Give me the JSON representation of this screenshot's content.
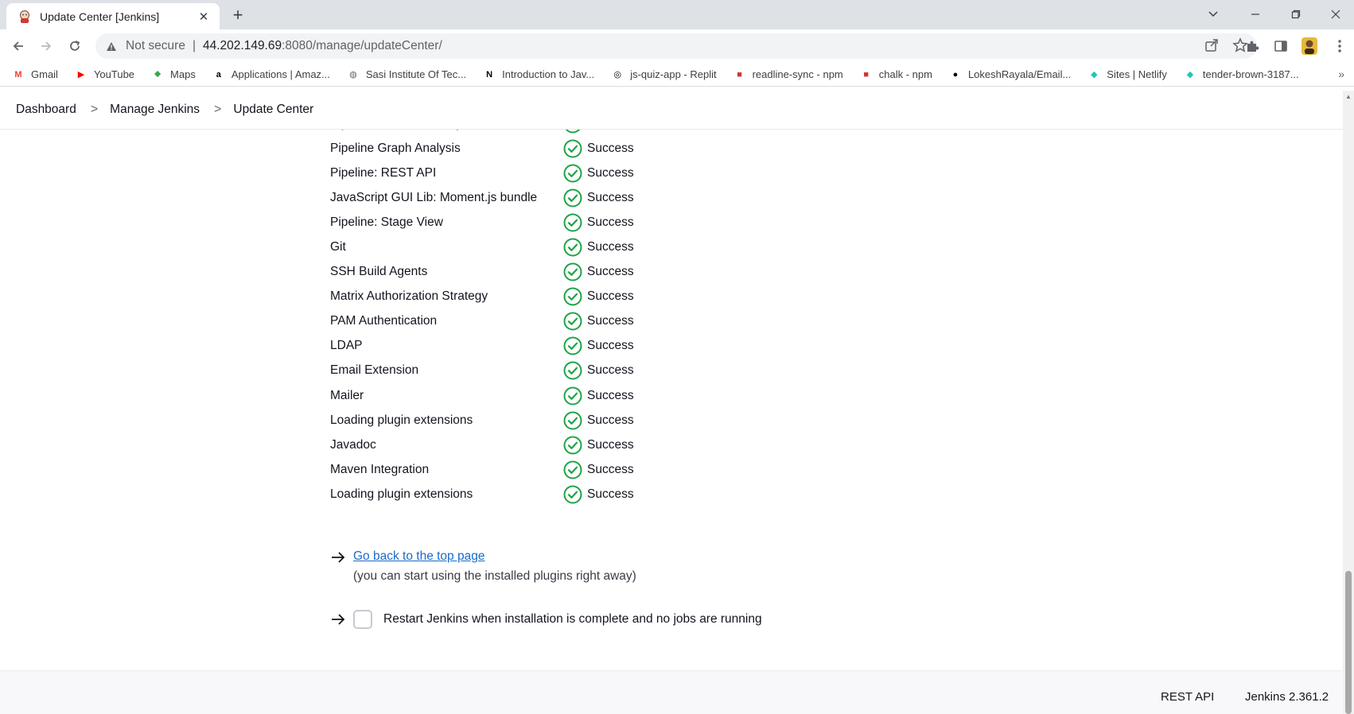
{
  "browser": {
    "tab_title": "Update Center [Jenkins]",
    "url_secure_label": "Not secure",
    "url_host": "44.202.149.69",
    "url_path": ":8080/manage/updateCenter/",
    "bookmarks": [
      {
        "label": "Gmail",
        "icon": "gmail-icon",
        "color": "#ea4335"
      },
      {
        "label": "YouTube",
        "icon": "youtube-icon",
        "color": "#ff0000"
      },
      {
        "label": "Maps",
        "icon": "maps-icon",
        "color": "#34a853"
      },
      {
        "label": "Applications | Amaz...",
        "icon": "amazon-icon",
        "color": "#000000"
      },
      {
        "label": "Sasi Institute Of Tec...",
        "icon": "globe-icon",
        "color": "#5f6368"
      },
      {
        "label": "Introduction to Jav...",
        "icon": "notion-icon",
        "color": "#000000"
      },
      {
        "label": "js-quiz-app - Replit",
        "icon": "replit-icon",
        "color": "#000000"
      },
      {
        "label": "readline-sync - npm",
        "icon": "npm-icon",
        "color": "#cb3837"
      },
      {
        "label": "chalk - npm",
        "icon": "npm-icon",
        "color": "#cb3837"
      },
      {
        "label": "LokeshRayala/Email...",
        "icon": "github-icon",
        "color": "#000000"
      },
      {
        "label": "Sites | Netlify",
        "icon": "netlify-icon",
        "color": "#20c6b7"
      },
      {
        "label": "tender-brown-3187...",
        "icon": "netlify-icon",
        "color": "#20c6b7"
      }
    ],
    "bookmarks_more": "»"
  },
  "breadcrumbs": {
    "items": [
      "Dashboard",
      "Manage Jenkins",
      "Update Center"
    ],
    "separator": ">"
  },
  "plugins": {
    "status_color": "#1ea446",
    "rows": [
      {
        "name": "Pipeline: GitHub Groovy Libraries",
        "status": "Success"
      },
      {
        "name": "Pipeline Graph Analysis",
        "status": "Success"
      },
      {
        "name": "Pipeline: REST API",
        "status": "Success"
      },
      {
        "name": "JavaScript GUI Lib: Moment.js bundle",
        "status": "Success"
      },
      {
        "name": "Pipeline: Stage View",
        "status": "Success"
      },
      {
        "name": "Git",
        "status": "Success"
      },
      {
        "name": "SSH Build Agents",
        "status": "Success"
      },
      {
        "name": "Matrix Authorization Strategy",
        "status": "Success"
      },
      {
        "name": "PAM Authentication",
        "status": "Success"
      },
      {
        "name": "LDAP",
        "status": "Success"
      },
      {
        "name": "Email Extension",
        "status": "Success"
      },
      {
        "name": "Mailer",
        "status": "Success"
      },
      {
        "name": "Loading plugin extensions",
        "status": "Success"
      },
      {
        "name": "Javadoc",
        "status": "Success"
      },
      {
        "name": "Maven Integration",
        "status": "Success"
      },
      {
        "name": "Loading plugin extensions",
        "status": "Success"
      }
    ]
  },
  "next_steps": {
    "top_link": "Go back to the top page",
    "top_note": "(you can start using the installed plugins right away)",
    "restart_label": "Restart Jenkins when installation is complete and no jobs are running",
    "restart_checked": false
  },
  "footer": {
    "rest_api": "REST API",
    "version": "Jenkins 2.361.2"
  }
}
